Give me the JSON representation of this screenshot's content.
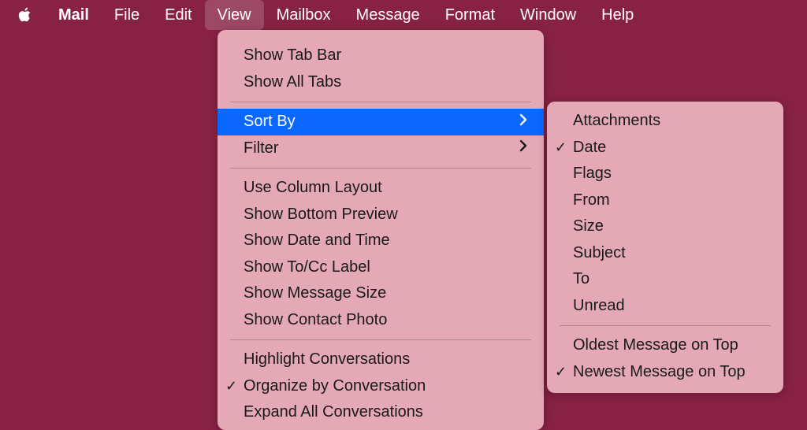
{
  "menubar": {
    "app": "Mail",
    "items": [
      "File",
      "Edit",
      "View",
      "Mailbox",
      "Message",
      "Format",
      "Window",
      "Help"
    ],
    "open_index": 2
  },
  "view_menu": {
    "group1": [
      "Show Tab Bar",
      "Show All Tabs"
    ],
    "sort_by": "Sort By",
    "filter": "Filter",
    "group3": [
      "Use Column Layout",
      "Show Bottom Preview",
      "Show Date and Time",
      "Show To/Cc Label",
      "Show Message Size",
      "Show Contact Photo"
    ],
    "group4": [
      "Highlight Conversations",
      "Organize by Conversation",
      "Expand All Conversations"
    ],
    "organize_checked": true
  },
  "sort_submenu": {
    "fields": [
      "Attachments",
      "Date",
      "Flags",
      "From",
      "Size",
      "Subject",
      "To",
      "Unread"
    ],
    "checked_field_index": 1,
    "order": [
      "Oldest Message on Top",
      "Newest Message on Top"
    ],
    "checked_order_index": 1
  }
}
